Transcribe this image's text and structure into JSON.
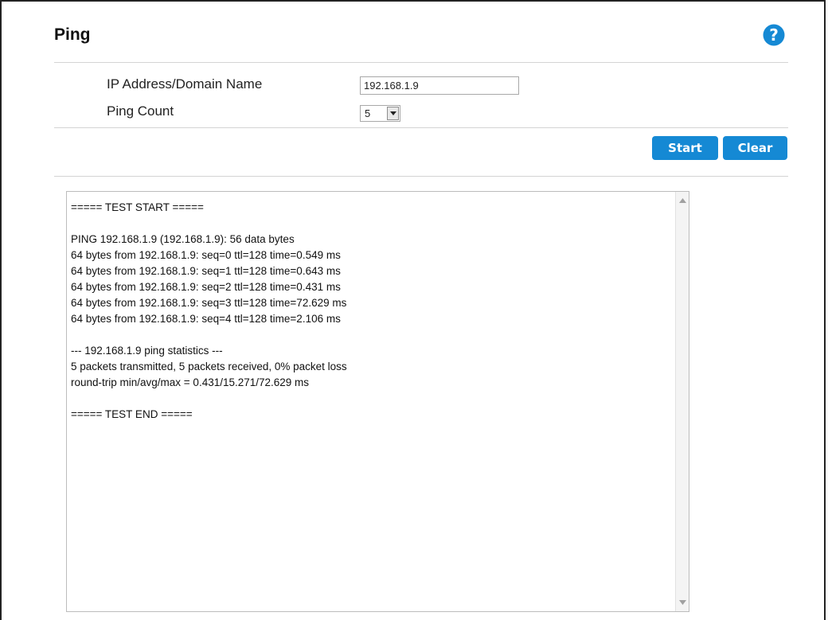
{
  "page": {
    "title": "Ping"
  },
  "form": {
    "ip_label": "IP Address/Domain Name",
    "ip_value": "192.168.1.9",
    "count_label": "Ping Count",
    "count_value": "5"
  },
  "buttons": {
    "start": "Start",
    "clear": "Clear"
  },
  "output": {
    "lines": [
      "===== TEST START =====",
      "",
      "PING 192.168.1.9 (192.168.1.9): 56 data bytes",
      "64 bytes from 192.168.1.9: seq=0 ttl=128 time=0.549 ms",
      "64 bytes from 192.168.1.9: seq=1 ttl=128 time=0.643 ms",
      "64 bytes from 192.168.1.9: seq=2 ttl=128 time=0.431 ms",
      "64 bytes from 192.168.1.9: seq=3 ttl=128 time=72.629 ms",
      "64 bytes from 192.168.1.9: seq=4 ttl=128 time=2.106 ms",
      "",
      "--- 192.168.1.9 ping statistics ---",
      "5 packets transmitted, 5 packets received, 0% packet loss",
      "round-trip min/avg/max = 0.431/15.271/72.629 ms",
      "",
      "===== TEST END ====="
    ]
  },
  "icons": {
    "help": "help-question-icon"
  },
  "colors": {
    "accent": "#1589d4",
    "divider": "#d4d4d4"
  }
}
